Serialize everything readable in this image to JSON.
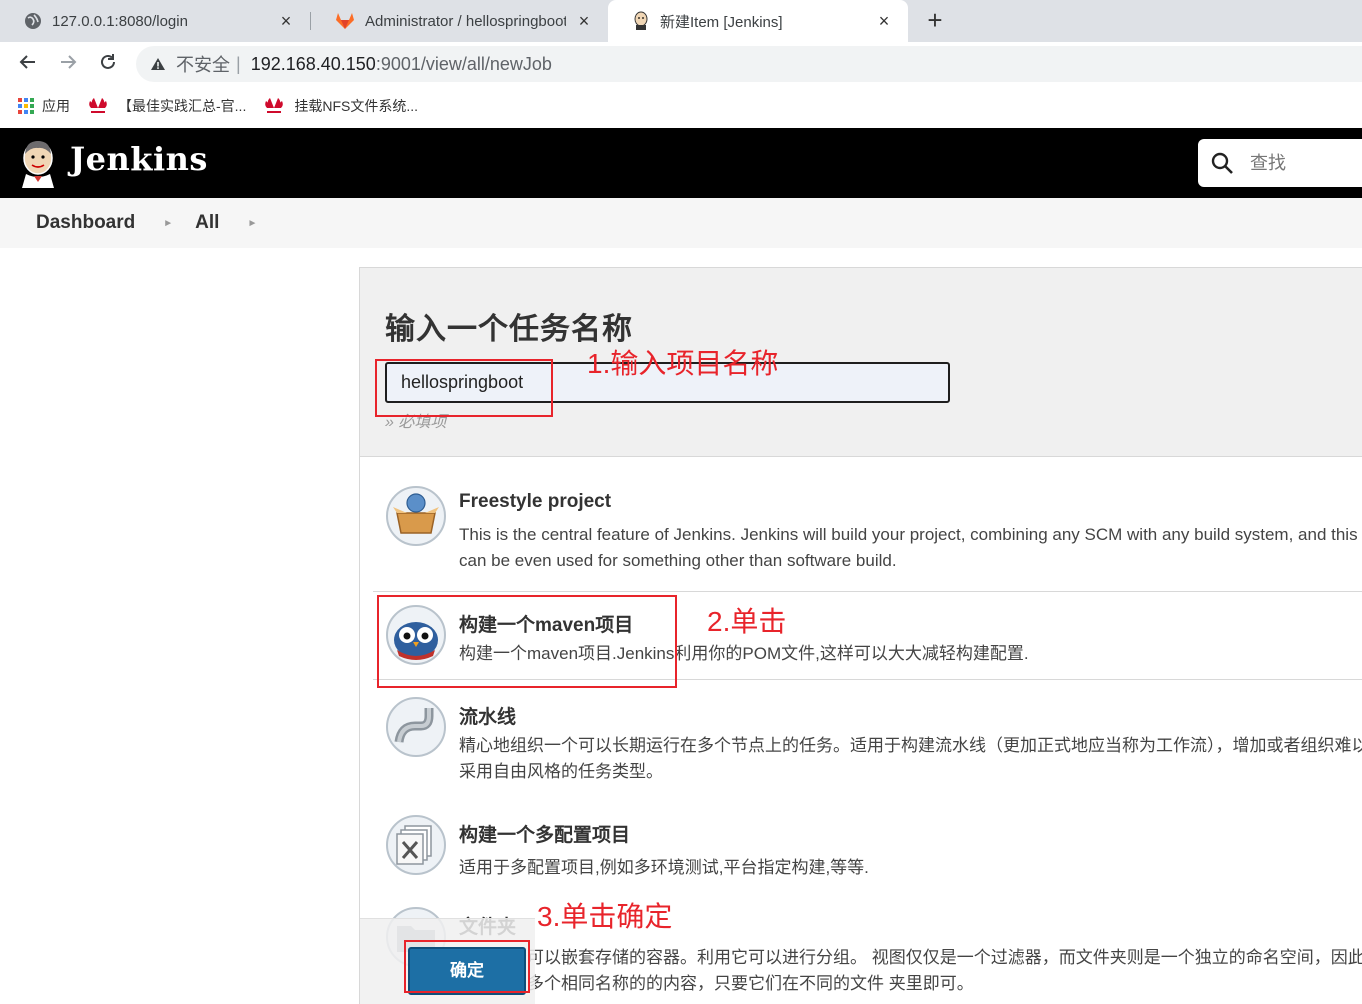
{
  "browser": {
    "tabs": [
      {
        "title": "127.0.0.1:8080/login",
        "close": "×"
      },
      {
        "title": "Administrator / hellospringboot",
        "close": "×"
      },
      {
        "title": "新建Item [Jenkins]",
        "close": "×"
      }
    ],
    "new_tab": "+",
    "address": {
      "insecure_label": "不安全",
      "divider": "|",
      "host": "192.168.40.150",
      "rest": ":9001/view/all/newJob"
    },
    "bookmarks": [
      {
        "label": "应用",
        "icon": "apps-grid-icon"
      },
      {
        "label": "【最佳实践汇总-官...",
        "icon": "huawei-icon"
      },
      {
        "label": "挂载NFS文件系统...",
        "icon": "huawei-icon"
      }
    ]
  },
  "jenkins": {
    "title": "Jenkins",
    "search_placeholder": "查找",
    "breadcrumb": [
      "Dashboard",
      "All"
    ]
  },
  "form": {
    "heading": "输入一个任务名称",
    "name_value": "hellospringboot",
    "required_hint": "» 必填项",
    "ok_label": "确定"
  },
  "items": [
    {
      "name": "Freestyle project",
      "desc": "This is the central feature of Jenkins. Jenkins will build your project, combining any SCM with any build system, and this can be even used for something other than software build.",
      "icon": "freestyle-box-icon"
    },
    {
      "name": "构建一个maven项目",
      "desc": "构建一个maven项目.Jenkins利用你的POM文件,这样可以大大减轻构建配置.",
      "icon": "maven-owl-icon"
    },
    {
      "name": "流水线",
      "desc": "精心地组织一个可以长期运行在多个节点上的任务。适用于构建流水线（更加正式地应当称为工作流），增加或者组织难以采用自由风格的任务类型。",
      "icon": "pipeline-icon"
    },
    {
      "name": "构建一个多配置项目",
      "desc": "适用于多配置项目,例如多环境测试,平台指定构建,等等.",
      "icon": "multi-config-icon"
    },
    {
      "name": "文件夹",
      "desc": "创建一个可以嵌套存储的容器。利用它可以进行分组。 视图仅仅是一个过滤器，而文件夹则是一个独立的命名空间，因此你可以有多个相同名称的的内容，只要它们在不同的文件 夹里即可。",
      "icon": "folder-icon"
    }
  ],
  "annotations": {
    "step1": "1.输入项目名称",
    "step2": "2.单击",
    "step3": "3.单击确定",
    "color": "#e8242b"
  }
}
